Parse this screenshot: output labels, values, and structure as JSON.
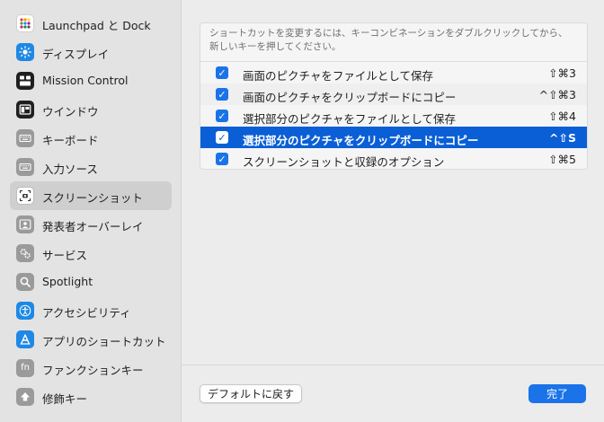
{
  "sidebar": {
    "items": [
      {
        "label": "Launchpad と Dock",
        "icon": "launchpad-icon",
        "color": "#ffffff"
      },
      {
        "label": "ディスプレイ",
        "icon": "display-icon",
        "color": "#1e88e5"
      },
      {
        "label": "Mission Control",
        "icon": "mission-control-icon",
        "color": "#1f1f1f"
      },
      {
        "label": "ウインドウ",
        "icon": "window-icon",
        "color": "#1f1f1f"
      },
      {
        "label": "キーボード",
        "icon": "keyboard-icon",
        "color": "#9a9a9a"
      },
      {
        "label": "入力ソース",
        "icon": "input-source-icon",
        "color": "#9a9a9a"
      },
      {
        "label": "スクリーンショット",
        "icon": "screenshot-icon",
        "color": "#ffffff"
      },
      {
        "label": "発表者オーバーレイ",
        "icon": "presenter-overlay-icon",
        "color": "#9a9a9a"
      },
      {
        "label": "サービス",
        "icon": "services-icon",
        "color": "#9a9a9a"
      },
      {
        "label": "Spotlight",
        "icon": "spotlight-icon",
        "color": "#9a9a9a"
      },
      {
        "label": "アクセシビリティ",
        "icon": "accessibility-icon",
        "color": "#1e88e5"
      },
      {
        "label": "アプリのショートカット",
        "icon": "app-shortcuts-icon",
        "color": "#1e88e5"
      },
      {
        "label": "ファンクションキー",
        "icon": "function-keys-icon",
        "color": "#9a9a9a"
      },
      {
        "label": "修飾キー",
        "icon": "modifier-keys-icon",
        "color": "#9a9a9a"
      }
    ],
    "selected_index": 6
  },
  "main": {
    "description_line1": "ショートカットを変更するには、キーコンビネーションをダブルクリックしてから、",
    "description_line2": "新しいキーを押してください。",
    "shortcuts": [
      {
        "label": "画面のピクチャをファイルとして保存",
        "keys": "⇧⌘3",
        "checked": true
      },
      {
        "label": "画面のピクチャをクリップボードにコピー",
        "keys": "^⇧⌘3",
        "checked": true
      },
      {
        "label": "選択部分のピクチャをファイルとして保存",
        "keys": "⇧⌘4",
        "checked": true
      },
      {
        "label": "選択部分のピクチャをクリップボードにコピー",
        "keys": "^⇧S",
        "checked": true,
        "selected": true
      },
      {
        "label": "スクリーンショットと収録のオプション",
        "keys": "⇧⌘5",
        "checked": true
      }
    ],
    "restore_defaults_label": "デフォルトに戻す",
    "done_label": "完了"
  },
  "colors": {
    "accent": "#1a73e8",
    "selection": "#0a5fd6"
  }
}
